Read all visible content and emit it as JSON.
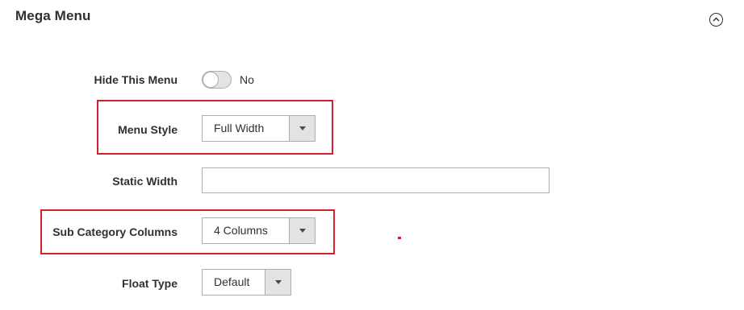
{
  "section": {
    "title": "Mega Menu",
    "collapse_icon": "chevron-up-circle-icon"
  },
  "fields": {
    "hide_menu": {
      "label": "Hide This Menu",
      "value": "No",
      "enabled": false
    },
    "menu_style": {
      "label": "Menu Style",
      "value": "Full Width"
    },
    "static_width": {
      "label": "Static Width",
      "value": ""
    },
    "sub_category_columns": {
      "label": "Sub Category Columns",
      "value": "4 Columns"
    },
    "float_type": {
      "label": "Float Type",
      "value": "Default"
    }
  },
  "colors": {
    "highlight": "#d3202f",
    "text": "#303030",
    "border": "#adadad",
    "button_bg": "#e3e3e3"
  }
}
